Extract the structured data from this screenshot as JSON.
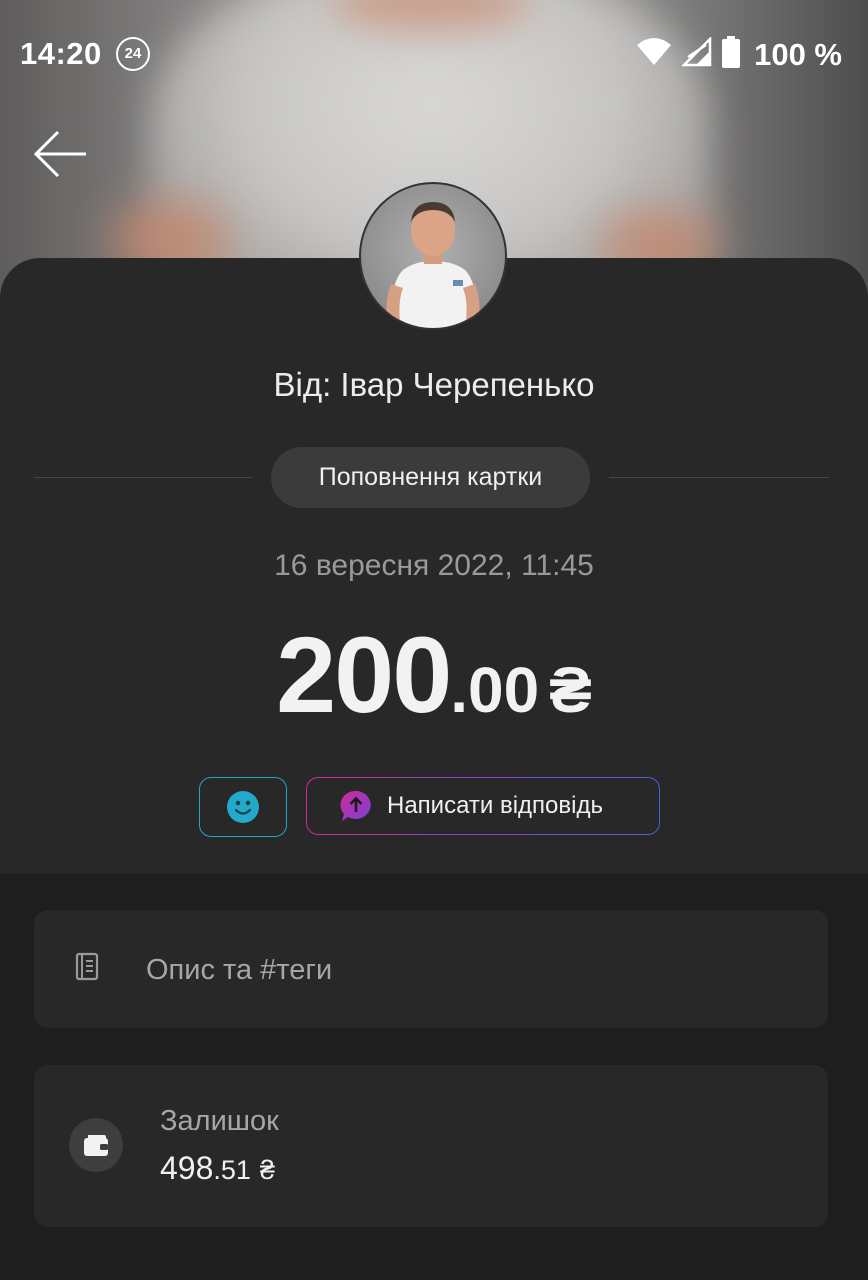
{
  "status_bar": {
    "time": "14:20",
    "badge": "24",
    "battery": "100 %"
  },
  "icons": {
    "back": "arrow-left-icon",
    "emoji": "smiley-icon",
    "reply": "chat-bubble-up-icon",
    "description": "notebook-icon",
    "balance": "wallet-icon"
  },
  "transaction": {
    "sender": "Від: Івар Черепенько",
    "type": "Поповнення картки",
    "datetime": "16 вересня 2022, 11:45",
    "amount_int": "200",
    "amount_frac": ".00",
    "currency": "₴"
  },
  "actions": {
    "reply_label": "Написати відповідь"
  },
  "details": {
    "description_label": "Опис та #теги",
    "balance_label": "Залишок",
    "balance_int": "498",
    "balance_frac": ".51",
    "balance_currency": "₴"
  },
  "colors": {
    "background": "#1e1e1e",
    "panel": "#282828",
    "emoji_accent": "#1fa8c9",
    "reply_gradient_start": "#d02a9a",
    "reply_gradient_end": "#4f5fe0"
  }
}
